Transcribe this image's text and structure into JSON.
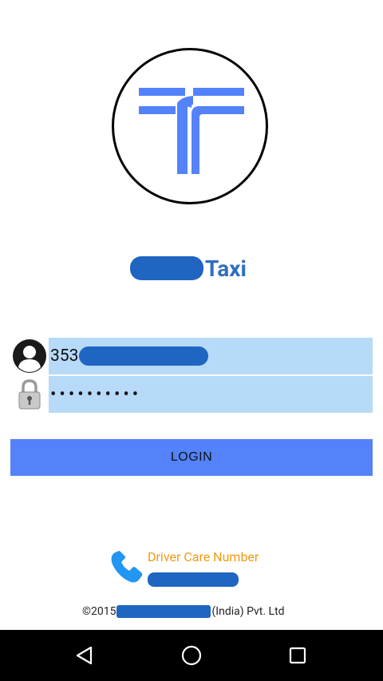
{
  "app": {
    "title_visible": "Taxi"
  },
  "login_form": {
    "phone_value": "353",
    "password_masked": "••••••••••",
    "login_label": "LOGIN"
  },
  "support": {
    "care_label": "Driver Care Number"
  },
  "footer": {
    "prefix": "©2015",
    "suffix": "(India) Pvt. Ltd"
  },
  "colors": {
    "accent": "#5382fb",
    "input_bg": "#b6daf8",
    "title": "#2f6fc0",
    "care_label": "#f29b10"
  },
  "icons": {
    "logo": "taxi-logo-icon",
    "user": "user-avatar-icon",
    "lock": "lock-icon",
    "phone": "phone-icon",
    "nav_back": "back-icon",
    "nav_home": "home-icon",
    "nav_recents": "recents-icon"
  }
}
